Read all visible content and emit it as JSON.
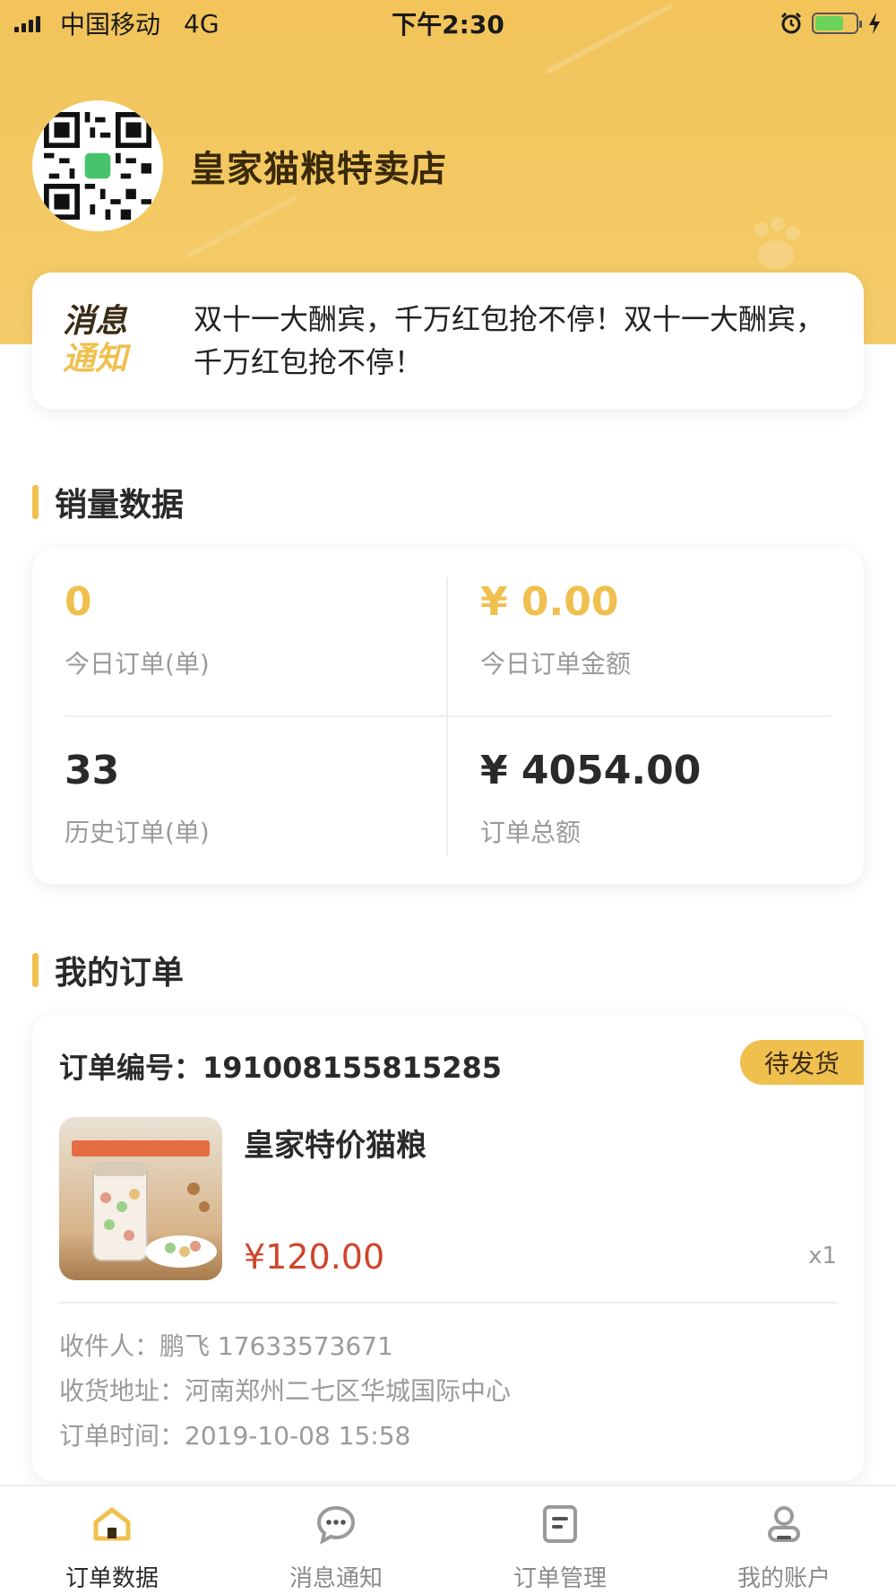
{
  "status_bar": {
    "carrier": "中国移动",
    "network": "4G",
    "time": "下午2:30"
  },
  "store": {
    "name": "皇家猫粮特卖店"
  },
  "notice": {
    "badge_line1": "消息",
    "badge_line2": "通知",
    "text": "双十一大酬宾，千万红包抢不停！双十一大酬宾，千万红包抢不停！"
  },
  "sales": {
    "title": "销量数据",
    "today_orders_value": "0",
    "today_orders_label": "今日订单(单)",
    "today_amount_value": "¥ 0.00",
    "today_amount_label": "今日订单金额",
    "history_orders_value": "33",
    "history_orders_label": "历史订单(单)",
    "total_amount_value": "¥ 4054.00",
    "total_amount_label": "订单总额"
  },
  "orders": {
    "title": "我的订单",
    "items": [
      {
        "number_label": "订单编号：",
        "number": "191008155815285",
        "status": "待发货",
        "product_name": "皇家特价猫粮",
        "price": "¥120.00",
        "qty": "x1",
        "recipient_label": "收件人：",
        "recipient": "鹏飞 17633573671",
        "address_label": "收货地址：",
        "address": "河南郑州二七区华城国际中心",
        "time_label": "订单时间：",
        "time": "2019-10-08 15:58"
      }
    ]
  },
  "tabbar": {
    "items": [
      {
        "label": "订单数据",
        "icon": "home-icon"
      },
      {
        "label": "消息通知",
        "icon": "chat-bubble-icon"
      },
      {
        "label": "订单管理",
        "icon": "document-icon"
      },
      {
        "label": "我的账户",
        "icon": "user-icon"
      }
    ],
    "active_index": 0
  },
  "colors": {
    "accent": "#f0c04f",
    "price_red": "#d0452b",
    "hero_bg": "#f2c45a"
  }
}
